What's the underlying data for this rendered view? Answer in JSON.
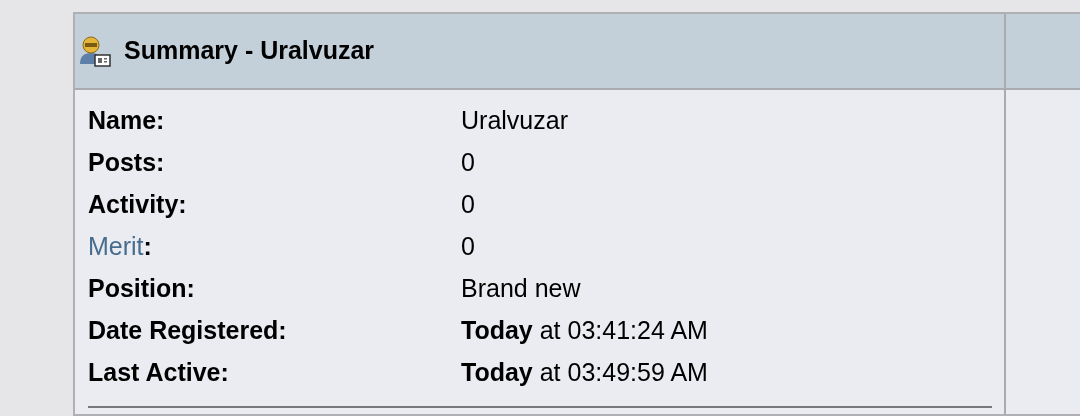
{
  "header": {
    "title": "Summary - Uralvuzar"
  },
  "rows": [
    {
      "kind": "plain",
      "label": "Name:",
      "value": "Uralvuzar"
    },
    {
      "kind": "plain",
      "label": "Posts:",
      "value": "0"
    },
    {
      "kind": "plain",
      "label": "Activity:",
      "value": "0"
    },
    {
      "kind": "link",
      "label": "Merit",
      "suffix": ":",
      "value": "0"
    },
    {
      "kind": "plain",
      "label": "Position:",
      "value": "Brand new"
    },
    {
      "kind": "plain",
      "label": "Date Registered:",
      "value": "**Today** at 03:41:24 AM"
    },
    {
      "kind": "plain",
      "label": "Last Active:",
      "value": "**Today** at 03:49:59 AM"
    }
  ]
}
